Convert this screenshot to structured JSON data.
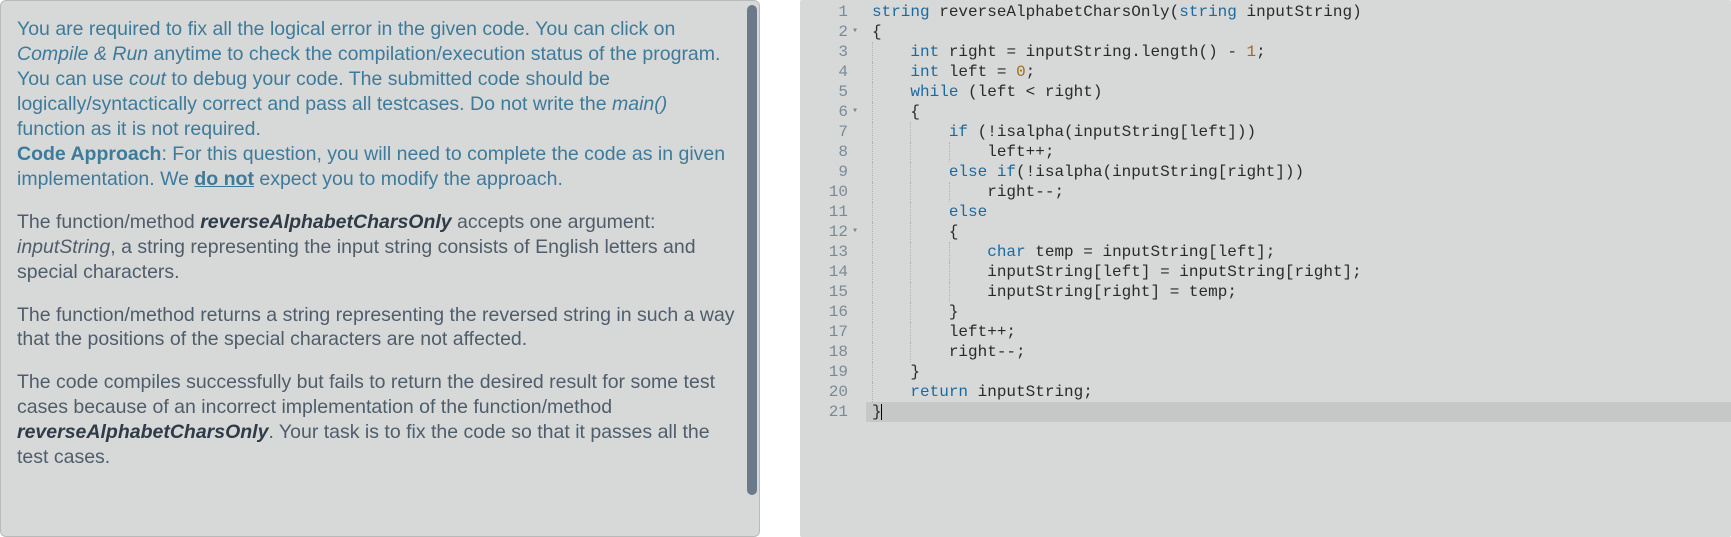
{
  "problem": {
    "intro_parts": {
      "p1a": "You are required to fix all the logical error in the given code. You can click on ",
      "compile_run": "Compile & Run",
      "p1b": " anytime to check the compilation/execution status of the program. You can use ",
      "cout": "cout",
      "p1c": " to debug your code. The submitted code should be logically/syntactically correct and pass all testcases. Do not write the ",
      "main": "main()",
      "p1d": " function as it is not required.",
      "approach_label": "Code Approach",
      "approach_a": ": For this question, you will need to complete the code as in given implementation. We ",
      "do_not": "do not",
      "approach_b": " expect you to modify the approach."
    },
    "para2": {
      "a": "The function/method ",
      "fn": "reverseAlphabetCharsOnly",
      "b": " accepts one argument: ",
      "arg": "inputString",
      "c": ", a string representing the input string consists of English letters and special characters."
    },
    "para3": "The function/method returns a string representing the reversed string in such a way that the positions of the special characters are not affected.",
    "para4": {
      "a": "The code compiles successfully but fails to return the desired result for some test cases because of an incorrect implementation of the function/method ",
      "fn": "reverseAlphabetCharsOnly",
      "b": ". Your task is to fix the code so that it passes all the test cases."
    }
  },
  "code": {
    "lines": [
      {
        "n": 1,
        "fold": "",
        "indent": 0,
        "html": "<span class='tok-type'>string</span> <span class='tok-func'>reverseAlphabetCharsOnly</span><span class='tok-op'>(</span><span class='tok-type'>string</span> <span class='tok-ident'>inputString</span><span class='tok-op'>)</span>"
      },
      {
        "n": 2,
        "fold": "▾",
        "indent": 0,
        "html": "<span class='tok-brace'>{</span>"
      },
      {
        "n": 3,
        "fold": "",
        "indent": 1,
        "html": "    <span class='tok-type'>int</span> <span class='tok-ident'>right</span> <span class='tok-op'>=</span> <span class='tok-ident'>inputString</span><span class='tok-op'>.</span><span class='tok-func'>length</span><span class='tok-op'>()</span> <span class='tok-op'>-</span> <span class='tok-num'>1</span><span class='tok-op'>;</span>"
      },
      {
        "n": 4,
        "fold": "",
        "indent": 1,
        "html": "    <span class='tok-type'>int</span> <span class='tok-ident'>left</span> <span class='tok-op'>=</span> <span class='tok-num'>0</span><span class='tok-op'>;</span>"
      },
      {
        "n": 5,
        "fold": "",
        "indent": 1,
        "html": "    <span class='tok-keyword'>while</span> <span class='tok-op'>(</span><span class='tok-ident'>left</span> <span class='tok-op'>&lt;</span> <span class='tok-ident'>right</span><span class='tok-op'>)</span>"
      },
      {
        "n": 6,
        "fold": "▾",
        "indent": 1,
        "html": "    <span class='tok-brace'>{</span>"
      },
      {
        "n": 7,
        "fold": "",
        "indent": 2,
        "html": "        <span class='tok-keyword'>if</span> <span class='tok-op'>(!</span><span class='tok-func'>isalpha</span><span class='tok-op'>(</span><span class='tok-ident'>inputString</span><span class='tok-op'>[</span><span class='tok-ident'>left</span><span class='tok-op'>]))</span>"
      },
      {
        "n": 8,
        "fold": "",
        "indent": 3,
        "html": "            <span class='tok-ident'>left</span><span class='tok-op'>++;</span>"
      },
      {
        "n": 9,
        "fold": "",
        "indent": 2,
        "html": "        <span class='tok-keyword'>else</span> <span class='tok-keyword'>if</span><span class='tok-op'>(!</span><span class='tok-func'>isalpha</span><span class='tok-op'>(</span><span class='tok-ident'>inputString</span><span class='tok-op'>[</span><span class='tok-ident'>right</span><span class='tok-op'>]))</span>"
      },
      {
        "n": 10,
        "fold": "",
        "indent": 3,
        "html": "            <span class='tok-ident'>right</span><span class='tok-op'>--;</span>"
      },
      {
        "n": 11,
        "fold": "",
        "indent": 2,
        "html": "        <span class='tok-keyword'>else</span>"
      },
      {
        "n": 12,
        "fold": "▾",
        "indent": 2,
        "html": "        <span class='tok-brace'>{</span>"
      },
      {
        "n": 13,
        "fold": "",
        "indent": 3,
        "html": "            <span class='tok-type'>char</span> <span class='tok-ident'>temp</span> <span class='tok-op'>=</span> <span class='tok-ident'>inputString</span><span class='tok-op'>[</span><span class='tok-ident'>left</span><span class='tok-op'>];</span>"
      },
      {
        "n": 14,
        "fold": "",
        "indent": 3,
        "html": "            <span class='tok-ident'>inputString</span><span class='tok-op'>[</span><span class='tok-ident'>left</span><span class='tok-op'>]</span> <span class='tok-op'>=</span> <span class='tok-ident'>inputString</span><span class='tok-op'>[</span><span class='tok-ident'>right</span><span class='tok-op'>];</span>"
      },
      {
        "n": 15,
        "fold": "",
        "indent": 3,
        "html": "            <span class='tok-ident'>inputString</span><span class='tok-op'>[</span><span class='tok-ident'>right</span><span class='tok-op'>]</span> <span class='tok-op'>=</span> <span class='tok-ident'>temp</span><span class='tok-op'>;</span>"
      },
      {
        "n": 16,
        "fold": "",
        "indent": 2,
        "html": "        <span class='tok-brace'>}</span>"
      },
      {
        "n": 17,
        "fold": "",
        "indent": 2,
        "html": "        <span class='tok-ident'>left</span><span class='tok-op'>++;</span>"
      },
      {
        "n": 18,
        "fold": "",
        "indent": 2,
        "html": "        <span class='tok-ident'>right</span><span class='tok-op'>--;</span>"
      },
      {
        "n": 19,
        "fold": "",
        "indent": 1,
        "html": "    <span class='tok-brace'>}</span>"
      },
      {
        "n": 20,
        "fold": "",
        "indent": 1,
        "html": "    <span class='tok-keyword'>return</span> <span class='tok-ident'>inputString</span><span class='tok-op'>;</span>"
      },
      {
        "n": 21,
        "fold": "",
        "indent": 0,
        "active": true,
        "html": "<span class='tok-brace'>}</span><span class='cursor'></span>"
      }
    ]
  }
}
